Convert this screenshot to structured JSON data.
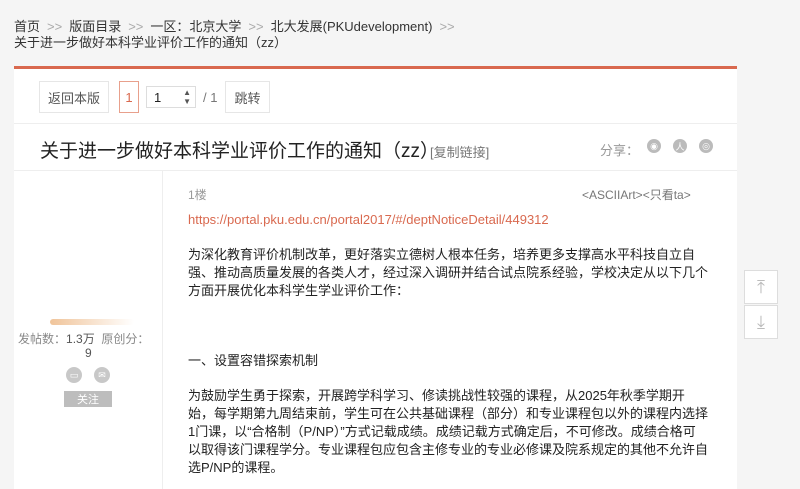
{
  "breadcrumb": {
    "items": [
      "首页",
      "版面目录",
      "一区：北京大学",
      "北大发展(PKUdevelopment)",
      "关于进一步做好本科学业评价工作的通知（zz）"
    ],
    "separator": ">>"
  },
  "pager": {
    "back_label": "返回本版",
    "current_page": "1",
    "input_value": "1",
    "total": "/ 1",
    "jump_label": "跳转"
  },
  "post_header": {
    "title": "关于进一步做好本科学业评价工作的通知（zz）",
    "copy_link": "[复制链接]",
    "share_label": "分享："
  },
  "user": {
    "posts_label": "发帖数：",
    "posts_value": "1.3万",
    "original_label": "原创分：",
    "original_value": "9",
    "follow_label": "关注"
  },
  "post": {
    "floor": "1楼",
    "ops": "<ASCIIArt><只看ta>",
    "link": "https://portal.pku.edu.cn/portal2017/#/deptNoticeDetail/449312",
    "intro": "为深化教育评价机制改革，更好落实立德树人根本任务，培养更多支撑高水平科技自立自强、推动高质量发展的各类人才，经过深入调研并结合试点院系经验，学校决定从以下几个方面开展优化本科学生学业评价工作：",
    "heading1": "一、设置容错探索机制",
    "para1": "为鼓励学生勇于探索，开展跨学科学习、修读挑战性较强的课程，从2025年秋季学期开始，每学期第九周结束前，学生可在公共基础课程（部分）和专业课程包以外的课程内选择1门课，以“合格制（P/NP）”方式记载成绩。成绩记载方式确定后，不可修改。成绩合格可以取得该门课程学分。专业课程包应包含主修专业的专业必修课及院系规定的其他不允许自选P/NP的课程。"
  },
  "colors": {
    "accent": "#d9694f"
  }
}
